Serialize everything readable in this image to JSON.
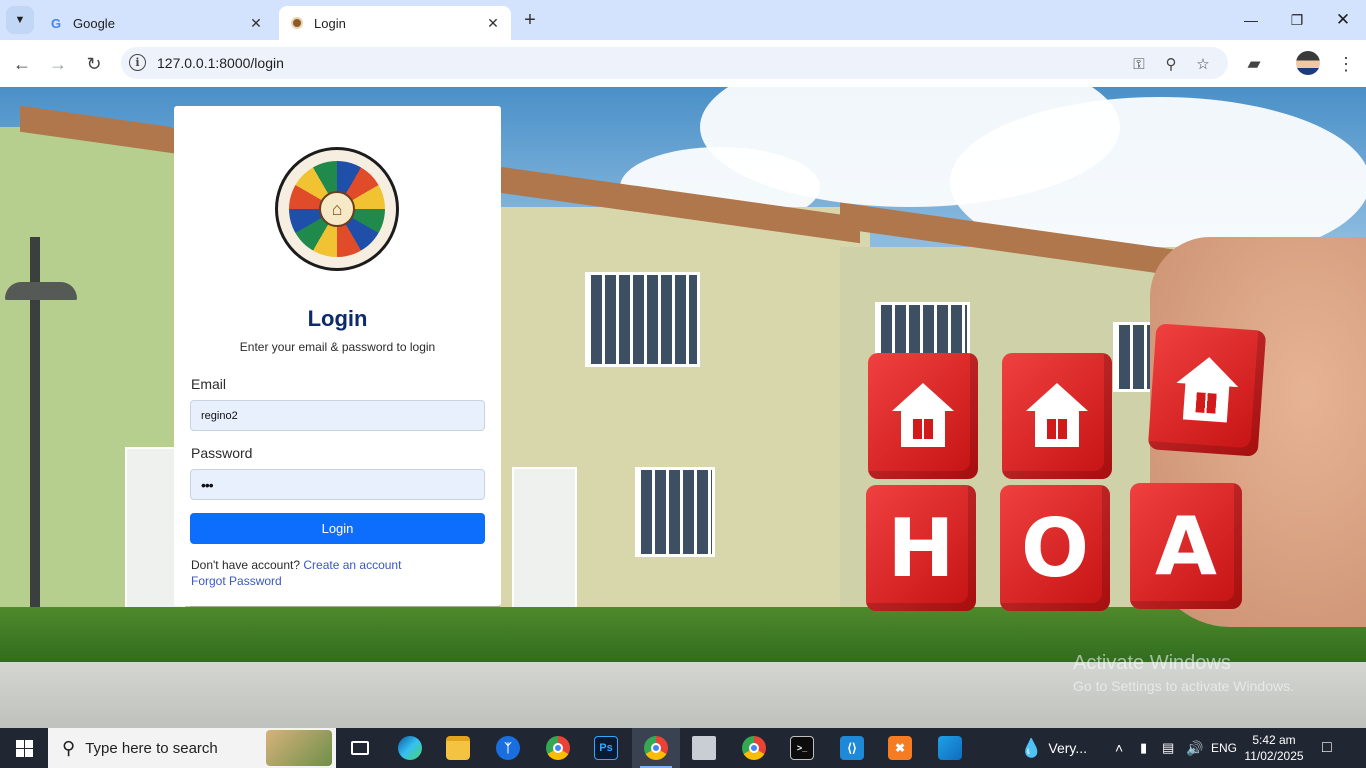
{
  "browser": {
    "tabs": [
      {
        "title": "Google",
        "active": false
      },
      {
        "title": "Login",
        "active": true
      }
    ],
    "url": "127.0.0.1:8000/login"
  },
  "login": {
    "title": "Login",
    "subtitle": "Enter your email & password to login",
    "email_label": "Email",
    "email_value": "regino2",
    "password_label": "Password",
    "password_value": "•••",
    "button_label": "Login",
    "no_account_text": "Don't have account?",
    "create_account_link": "Create an account",
    "forgot_password_link": "Forgot Password"
  },
  "background": {
    "cube_letters": [
      "H",
      "O",
      "A"
    ]
  },
  "watermark": {
    "line1": "Activate Windows",
    "line2": "Go to Settings to activate Windows."
  },
  "taskbar": {
    "search_placeholder": "Type here to search",
    "weather": "Very...",
    "language": "ENG",
    "time": "5:42 am",
    "date": "11/02/2025"
  },
  "colors": {
    "primary_button": "#0d6efd",
    "link": "#3b57c4",
    "title": "#0d2a6b"
  }
}
